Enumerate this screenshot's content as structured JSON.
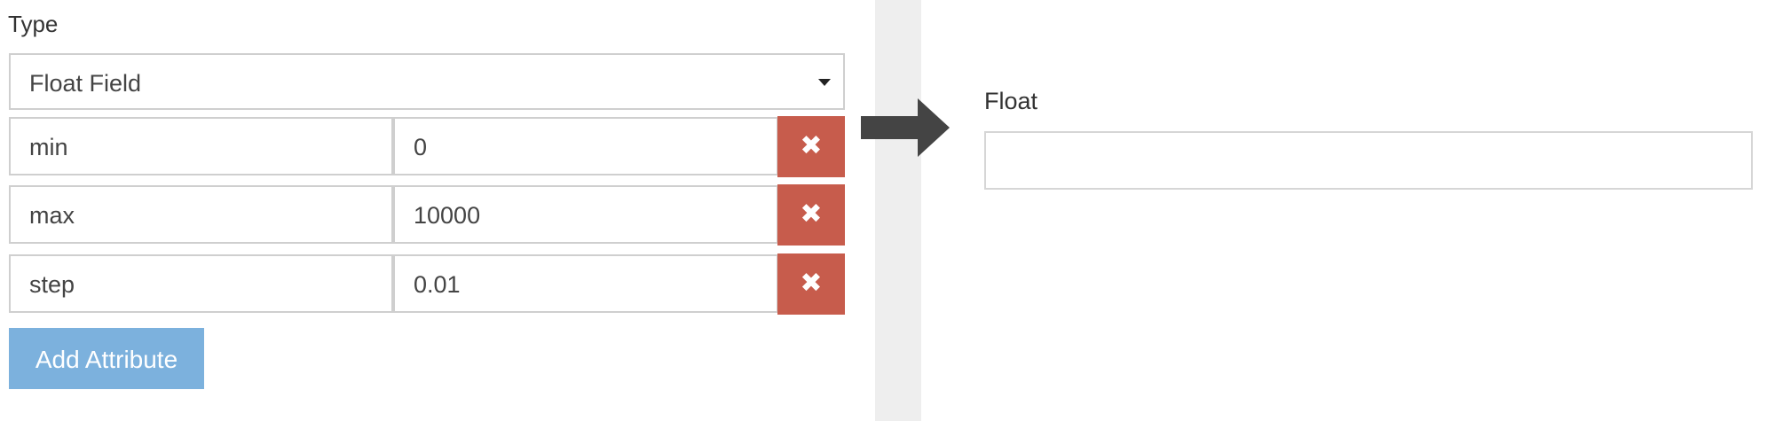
{
  "editor": {
    "type_label": "Type",
    "type_select": {
      "selected": "Float Field",
      "caret_icon": "caret-down-icon"
    },
    "attributes": [
      {
        "name": "min",
        "value": "0",
        "remove_icon": "close-icon"
      },
      {
        "name": "max",
        "value": "10000",
        "remove_icon": "close-icon"
      },
      {
        "name": "step",
        "value": "0.01",
        "remove_icon": "close-icon"
      }
    ],
    "remove_glyph": "✖",
    "add_attribute_label": "Add Attribute"
  },
  "arrow_icon": "arrow-right-icon",
  "preview": {
    "label": "Float",
    "input_value": ""
  },
  "colors": {
    "remove_button": "#c75c4c",
    "add_button": "#7cb1dd",
    "divider": "#eeeeee",
    "arrow": "#444444",
    "border": "#cfcfcf"
  }
}
